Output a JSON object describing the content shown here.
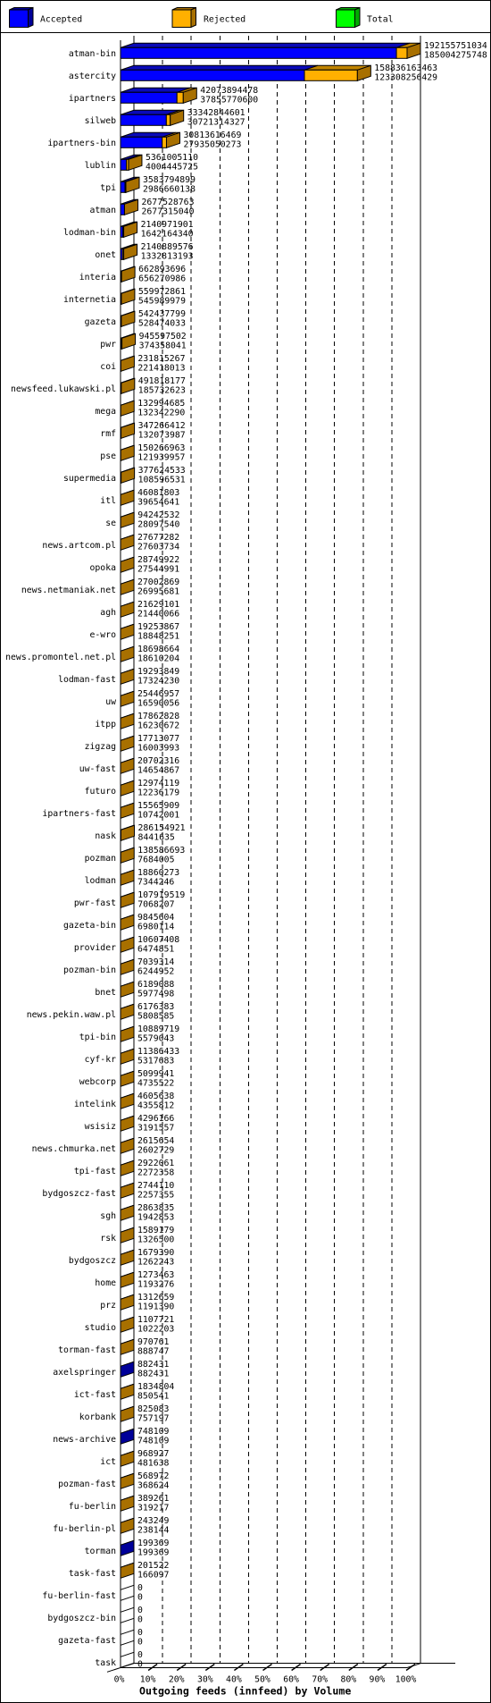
{
  "colors": {
    "accepted": "#0000ff",
    "accepted_top": "#0a0ab8",
    "accepted_side": "#000099",
    "rejected": "#ffb000",
    "rejected_top": "#c08400",
    "rejected_side": "#a87000",
    "total": "#00ff00",
    "total_side": "#00aa00"
  },
  "chart_data": {
    "type": "bar",
    "orientation": "horizontal",
    "title": "Outgoing feeds (innfeed) by Volume",
    "xlabel": "Outgoing feeds (innfeed) by Volume",
    "ylabel": "",
    "xlim": [
      0,
      100
    ],
    "x_unit": "percent of largest total",
    "x_ticks": [
      "0%",
      "10%",
      "20%",
      "30%",
      "40%",
      "50%",
      "60%",
      "70%",
      "80%",
      "90%",
      "100%"
    ],
    "grid": true,
    "legend_position": "top",
    "legend": [
      "Accepted",
      "Rejected",
      "Total"
    ],
    "categories": [
      "atman-bin",
      "astercity",
      "ipartners",
      "silweb",
      "ipartners-bin",
      "lublin",
      "tpi",
      "atman",
      "lodman-bin",
      "onet",
      "interia",
      "internetia",
      "gazeta",
      "pwr",
      "coi",
      "newsfeed.lukawski.pl",
      "mega",
      "rmf",
      "pse",
      "supermedia",
      "itl",
      "se",
      "news.artcom.pl",
      "opoka",
      "news.netmaniak.net",
      "agh",
      "e-wro",
      "news.promontel.net.pl",
      "lodman-fast",
      "uw",
      "itpp",
      "zigzag",
      "uw-fast",
      "futuro",
      "ipartners-fast",
      "nask",
      "pozman",
      "lodman",
      "pwr-fast",
      "gazeta-bin",
      "provider",
      "pozman-bin",
      "bnet",
      "news.pekin.waw.pl",
      "tpi-bin",
      "cyf-kr",
      "webcorp",
      "intelink",
      "wsisiz",
      "news.chmurka.net",
      "tpi-fast",
      "bydgoszcz-fast",
      "sgh",
      "rsk",
      "bydgoszcz",
      "home",
      "prz",
      "studio",
      "torman-fast",
      "axelspringer",
      "ict-fast",
      "korbank",
      "news-archive",
      "ict",
      "pozman-fast",
      "fu-berlin",
      "fu-berlin-pl",
      "torman",
      "task-fast",
      "fu-berlin-fast",
      "bydgoszcz-bin",
      "gazeta-fast",
      "task"
    ],
    "series": [
      {
        "name": "Total",
        "values": [
          192155751034,
          158836163463,
          42073894478,
          33342844601,
          30813616469,
          5361005110,
          3583794899,
          2677528763,
          2140971901,
          2140889576,
          662893696,
          559972861,
          542437799,
          945597502,
          231815267,
          491818177,
          132994685,
          347266412,
          150266963,
          377624533,
          46081803,
          94242532,
          27677282,
          28749922,
          27002869,
          21629101,
          19253867,
          18698664,
          19293849,
          25446957,
          17862828,
          17713077,
          20702316,
          12974119,
          15565909,
          286154921,
          138586693,
          18860273,
          107919519,
          9845604,
          10607408,
          7039314,
          6189088,
          6176383,
          10889719,
          11386433,
          5099941,
          4605638,
          4296166,
          2615654,
          2922061,
          2744110,
          2863835,
          1589179,
          1679390,
          1273463,
          1312659,
          1107721,
          970761,
          882431,
          1834804,
          825083,
          748109,
          968927,
          568972,
          389261,
          243249,
          199369,
          201522,
          0,
          0,
          0,
          0
        ]
      },
      {
        "name": "Accepted",
        "values": [
          185004275748,
          123308256429,
          37855770600,
          30721314327,
          27935050273,
          4004445725,
          2986660138,
          2677315040,
          1642164340,
          1332813193,
          656270986,
          545989979,
          528474033,
          374358041,
          221418013,
          185732623,
          132342290,
          132073987,
          121939957,
          108596531,
          39654641,
          28097540,
          27603734,
          27544991,
          26995681,
          21440066,
          18848251,
          18610204,
          17324230,
          16590056,
          16230672,
          16003993,
          14654867,
          12236179,
          10742001,
          8441635,
          7684005,
          7344246,
          7068207,
          6980114,
          6474851,
          6244952,
          5977498,
          5808585,
          5579043,
          5317683,
          4735522,
          4355812,
          3191557,
          2602729,
          2272358,
          2257355,
          1942853,
          1326500,
          1262243,
          1193276,
          1191390,
          1022203,
          888747,
          882431,
          850541,
          757197,
          748109,
          481638,
          368624,
          319217,
          238144,
          199369,
          166097,
          0,
          0,
          0,
          0
        ]
      }
    ]
  }
}
